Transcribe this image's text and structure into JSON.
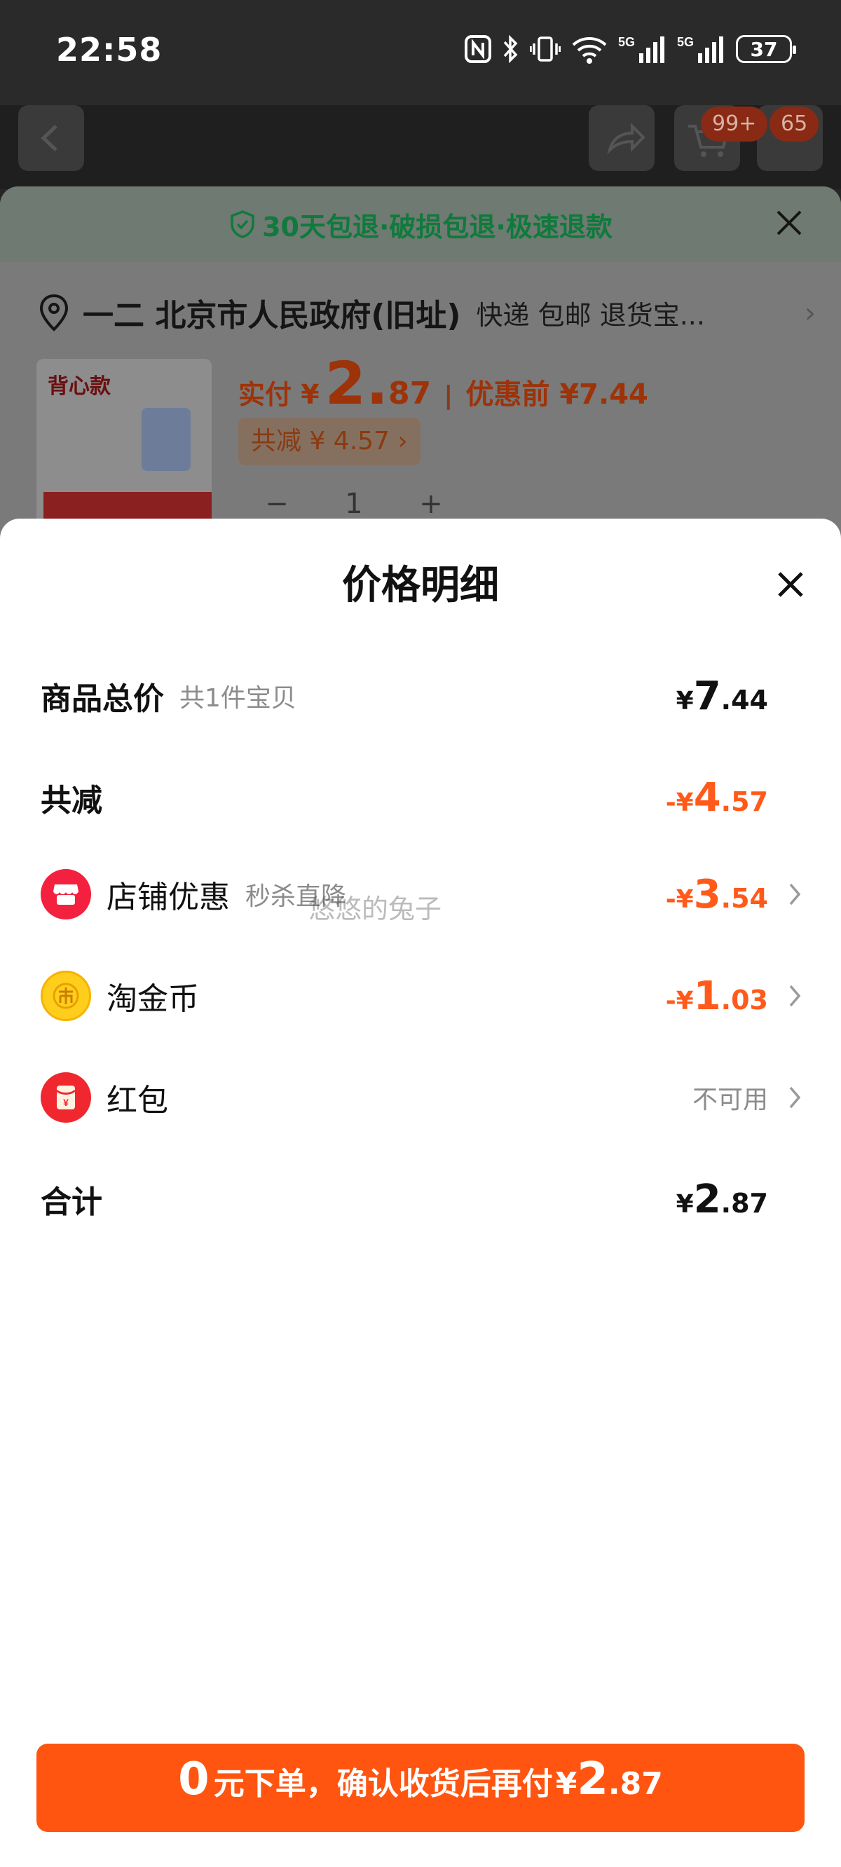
{
  "status_bar": {
    "time": "22:58",
    "battery": "37",
    "signal_label": "5G"
  },
  "background": {
    "badges": [
      "99+",
      "65"
    ],
    "guarantee_text": "30天包退·破损包退·极速退款",
    "address_name": "一二 北京市人民政府(旧址)",
    "address_extra": "快递 包邮 退货宝...",
    "product_label": "背心款",
    "price_label": "实付 ¥",
    "price_int": "2.",
    "price_dec": "87",
    "price_sep": "|",
    "price_before": "优惠前 ¥7.44",
    "discount_chip": "共减 ¥ 4.57 ›",
    "qty_minus": "−",
    "qty_value": "1",
    "qty_plus": "+"
  },
  "sheet": {
    "title": "价格明细",
    "rows": [
      {
        "label": "商品总价",
        "sub": "共1件宝贝",
        "cur": "¥",
        "int": "7",
        "dec": ".44"
      },
      {
        "label": "共减",
        "cur": "-¥",
        "int": "4",
        "dec": ".57"
      },
      {
        "label": "店铺优惠",
        "sub": "秒杀直降",
        "cur": "-¥",
        "int": "3",
        "dec": ".54",
        "icon": "shop-icon"
      },
      {
        "label": "淘金币",
        "cur": "-¥",
        "int": "1",
        "dec": ".03",
        "icon": "coin-icon"
      },
      {
        "label": "红包",
        "status": "不可用",
        "icon": "red-envelope-icon"
      },
      {
        "label": "合计",
        "cur": "¥",
        "int": "2",
        "dec": ".87"
      }
    ],
    "watermark": "悠悠的兔子"
  },
  "cta": {
    "num": "0",
    "text": "元下单，确认收货后再付",
    "cur": "¥",
    "int": "2",
    "dec": ".87"
  },
  "colors": {
    "accent": "#ff5510",
    "discount": "#ff5a1a",
    "guarantee": "#0f7a3c"
  }
}
